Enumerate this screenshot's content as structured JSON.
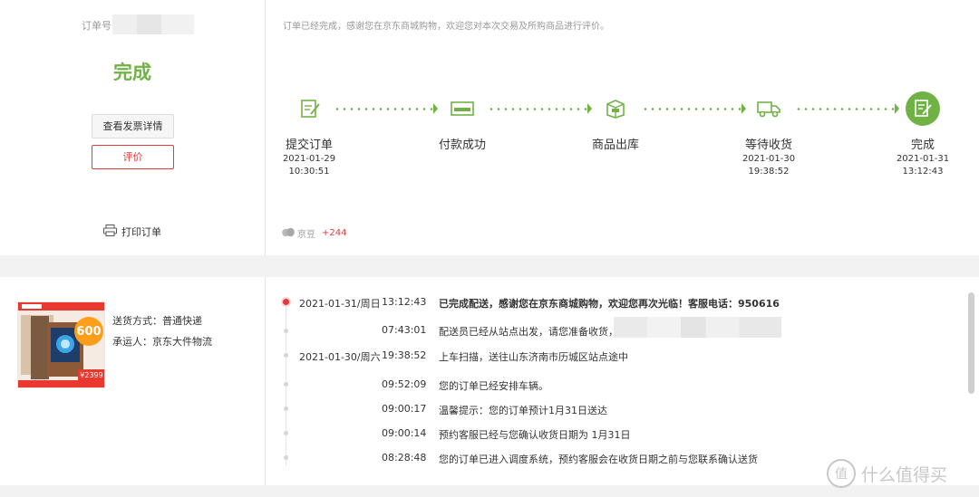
{
  "order": {
    "number_label": "订单号:",
    "status": "完成",
    "invoice_button": "查看发票详情",
    "review_button": "评价",
    "print_label": "打印订单"
  },
  "progress": {
    "notice": "订单已经完成，感谢您在京东商城购物，欢迎您对本次交易及所购商品进行评价。",
    "steps": [
      {
        "label": "提交订单",
        "date": "2021-01-29",
        "time": "10:30:51",
        "icon": "edit-document-icon"
      },
      {
        "label": "付款成功",
        "date": "",
        "time": "",
        "icon": "card-icon"
      },
      {
        "label": "商品出库",
        "date": "",
        "time": "",
        "icon": "package-icon"
      },
      {
        "label": "等待收货",
        "date": "2021-01-30",
        "time": "19:38:52",
        "icon": "truck-icon"
      },
      {
        "label": "完成",
        "date": "2021-01-31",
        "time": "13:12:43",
        "icon": "check-document-icon"
      }
    ],
    "accent_color": "#71b247"
  },
  "jd_bean": {
    "label": "京豆",
    "value": "+244"
  },
  "shipping": {
    "method": "送货方式：普通快递",
    "carrier": "承运人：京东大件物流",
    "product_badge": "600",
    "product_price": "¥2399"
  },
  "timeline": [
    {
      "date": "2021-01-31/周日",
      "time": "13:12:43",
      "text": "已完成配送，感谢您在京东商城购物，欢迎您再次光临！客服电话：950616",
      "bold": true
    },
    {
      "date": "",
      "time": "07:43:01",
      "text": "配送员已经从站点出发，请您准备收货，"
    },
    {
      "date": "2021-01-30/周六",
      "time": "19:38:52",
      "text": "上车扫描，送往山东济南市历城区站点途中"
    },
    {
      "date": "",
      "time": "09:52:09",
      "text": "您的订单已经安排车辆。"
    },
    {
      "date": "",
      "time": "09:00:17",
      "text": "温馨提示：您的订单预计1月31日送达"
    },
    {
      "date": "",
      "time": "09:00:14",
      "text": "预约客服已经与您确认收货日期为 1月31日"
    },
    {
      "date": "",
      "time": "08:28:48",
      "text": "您的订单已进入调度系统，预约客服会在收货日期之前与您联系确认送货"
    }
  ],
  "watermark": {
    "text": "什么值得买",
    "logo": "值"
  }
}
